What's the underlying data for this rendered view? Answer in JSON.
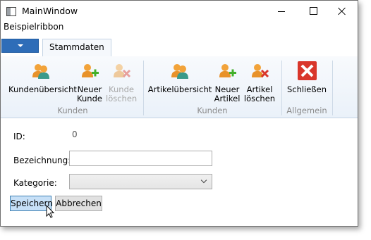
{
  "window": {
    "title": "MainWindow"
  },
  "menu": {
    "label": "Beispielribbon"
  },
  "ribbon": {
    "tab_label": "Stammdaten",
    "groups": [
      {
        "label": "Kunden",
        "buttons": [
          {
            "label": "Kundenübersicht",
            "icon": "customers-overview-icon",
            "enabled": true
          },
          {
            "line1": "Neuer",
            "line2": "Kunde",
            "icon": "new-customer-icon",
            "enabled": true
          },
          {
            "line1": "Kunde",
            "line2": "löschen",
            "icon": "delete-customer-icon",
            "enabled": false
          }
        ]
      },
      {
        "label": "Kunden",
        "buttons": [
          {
            "label": "Artikelübersicht",
            "icon": "articles-overview-icon",
            "enabled": true
          },
          {
            "line1": "Neuer",
            "line2": "Artikel",
            "icon": "new-article-icon",
            "enabled": true
          },
          {
            "line1": "Artikel",
            "line2": "löschen",
            "icon": "delete-article-icon",
            "enabled": true
          }
        ]
      },
      {
        "label": "Allgemein",
        "buttons": [
          {
            "label": "Schließen",
            "icon": "close-red-x-icon",
            "enabled": true
          }
        ]
      }
    ]
  },
  "form": {
    "id_label": "ID:",
    "id_value": "0",
    "bezeichnung_label": "Bezeichnung:",
    "bezeichnung_value": "",
    "kategorie_label": "Kategorie:",
    "kategorie_value": ""
  },
  "buttons": {
    "save": "Speichern",
    "cancel": "Abbrechen"
  },
  "colors": {
    "accent": "#2e6db8",
    "person_orange": "#f0a030",
    "person_teal": "#3a9a8a",
    "plus_green": "#43b02a",
    "delete_red": "#d9362b"
  }
}
